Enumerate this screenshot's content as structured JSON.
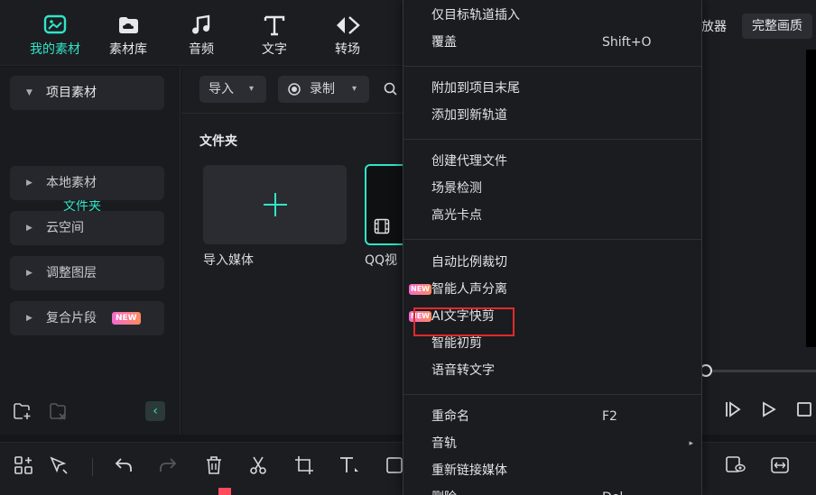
{
  "top_tabs": [
    {
      "label": "我的素材",
      "icon": "media-icon"
    },
    {
      "label": "素材库",
      "icon": "cloud-folder-icon"
    },
    {
      "label": "音频",
      "icon": "music-note-icon"
    },
    {
      "label": "文字",
      "icon": "text-t-icon"
    },
    {
      "label": "转场",
      "icon": "transition-icon"
    }
  ],
  "top_right": {
    "label_a": "放器",
    "label_b": "完整画质"
  },
  "sidebar": {
    "items": [
      {
        "label": "项目素材"
      },
      {
        "label": "本地素材"
      },
      {
        "label": "云空间"
      },
      {
        "label": "调整图层"
      },
      {
        "label": "复合片段",
        "badge": "NEW"
      }
    ],
    "sub_item": "文件夹"
  },
  "media": {
    "import_label": "导入",
    "record_label": "录制",
    "section_title": "文件夹",
    "import_card_label": "导入媒体",
    "video_card_label": "QQ视"
  },
  "context_menu": {
    "items": [
      {
        "label": "仅目标轨道插入"
      },
      {
        "label": "覆盖",
        "shortcut": "Shift+O"
      },
      {
        "label": "附加到项目末尾"
      },
      {
        "label": "添加到新轨道"
      },
      {
        "label": "创建代理文件"
      },
      {
        "label": "场景检测"
      },
      {
        "label": "高光卡点"
      },
      {
        "label": "自动比例裁切"
      },
      {
        "label": "智能人声分离",
        "badge": "NEW"
      },
      {
        "label": "AI文字快剪",
        "badge": "NEW"
      },
      {
        "label": "智能初剪"
      },
      {
        "label": "语音转文字"
      },
      {
        "label": "重命名",
        "shortcut": "F2"
      },
      {
        "label": "音轨",
        "submenu": "▸"
      },
      {
        "label": "重新链接媒体"
      },
      {
        "label": "删除",
        "shortcut": "Del"
      }
    ]
  },
  "colors": {
    "accent": "#2fe5c8",
    "highlight": "#e02a2a",
    "new_badge": "#f36ad0"
  }
}
